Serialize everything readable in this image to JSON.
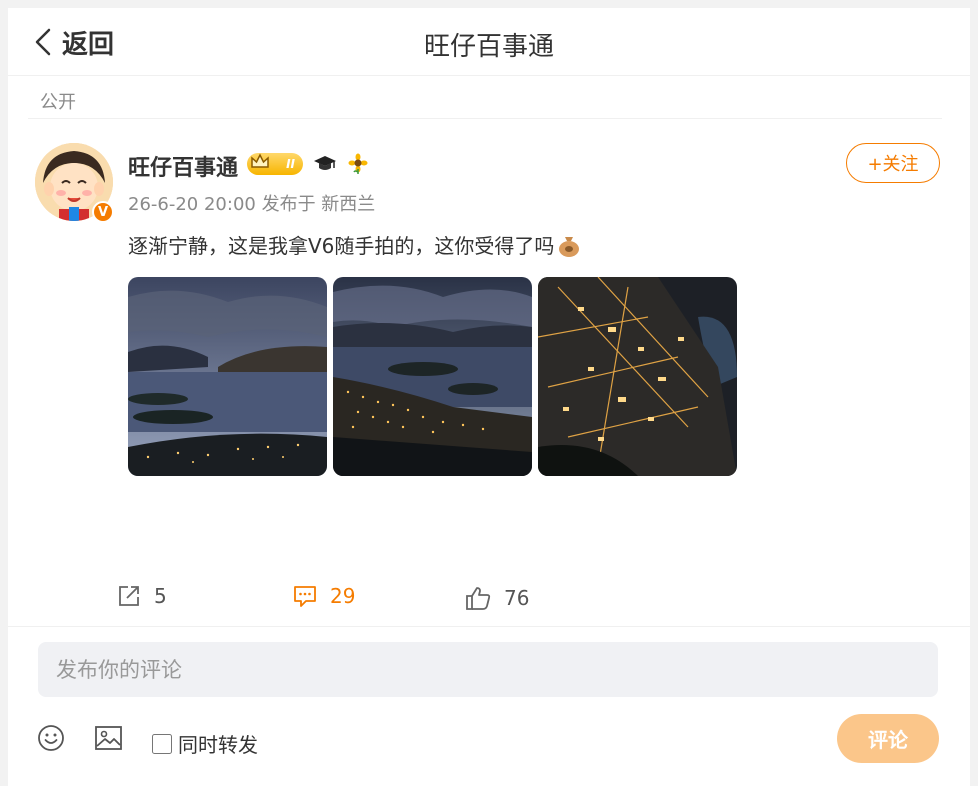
{
  "header": {
    "back_label": "返回",
    "title": "旺仔百事通"
  },
  "post": {
    "visibility": "公开",
    "author": {
      "name": "旺仔百事通",
      "level_badge": "II",
      "verified_mark": "V"
    },
    "meta": "26-6-20 20:00 发布于 新西兰",
    "follow_label": "+关注",
    "text": "逐渐宁静，这是我拿V6随手拍的，这你受得了吗",
    "photos": [
      "lake-dusk-photo",
      "lake-town-photo",
      "town-lights-photo"
    ]
  },
  "actions": {
    "repost_count": "5",
    "comment_count": "29",
    "like_count": "76"
  },
  "composer": {
    "placeholder": "发布你的评论",
    "repost_checkbox_label": "同时转发",
    "submit_label": "评论"
  },
  "colors": {
    "accent": "#f57c00",
    "submit_bg": "#fbc68a",
    "muted": "#8a8a8a"
  }
}
